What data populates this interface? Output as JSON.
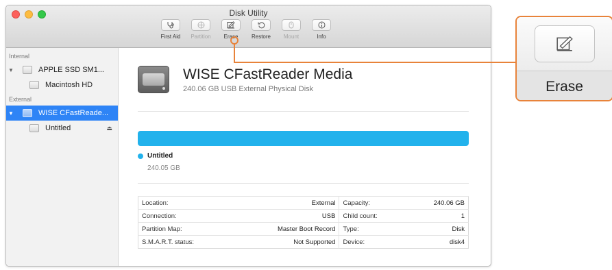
{
  "window": {
    "title": "Disk Utility"
  },
  "toolbar": [
    {
      "label": "First Aid",
      "icon": "stethoscope-icon",
      "enabled": true
    },
    {
      "label": "Partition",
      "icon": "partition-icon",
      "enabled": false
    },
    {
      "label": "Erase",
      "icon": "erase-icon",
      "enabled": true
    },
    {
      "label": "Restore",
      "icon": "restore-icon",
      "enabled": true
    },
    {
      "label": "Mount",
      "icon": "mount-icon",
      "enabled": false
    },
    {
      "label": "Info",
      "icon": "info-icon",
      "enabled": true
    }
  ],
  "sidebar": {
    "internal_label": "Internal",
    "external_label": "External",
    "internal_disk": "APPLE SSD SM1...",
    "internal_volume": "Macintosh HD",
    "external_disk": "WISE CFastReade...",
    "external_volume": "Untitled"
  },
  "disk": {
    "name": "WISE CFastReader Media",
    "subtitle": "240.06 GB USB External Physical Disk"
  },
  "usage": {
    "volume_name": "Untitled",
    "volume_size": "240.05 GB",
    "fill_fraction": 1.0,
    "color": "#22b2ec"
  },
  "info_table": [
    {
      "l1": "Location:",
      "v1": "External",
      "l2": "Capacity:",
      "v2": "240.06 GB"
    },
    {
      "l1": "Connection:",
      "v1": "USB",
      "l2": "Child count:",
      "v2": "1"
    },
    {
      "l1": "Partition Map:",
      "v1": "Master Boot Record",
      "l2": "Type:",
      "v2": "Disk"
    },
    {
      "l1": "S.M.A.R.T. status:",
      "v1": "Not Supported",
      "l2": "Device:",
      "v2": "disk4"
    }
  ],
  "callout": {
    "label": "Erase",
    "accent_color": "#e8833a"
  }
}
